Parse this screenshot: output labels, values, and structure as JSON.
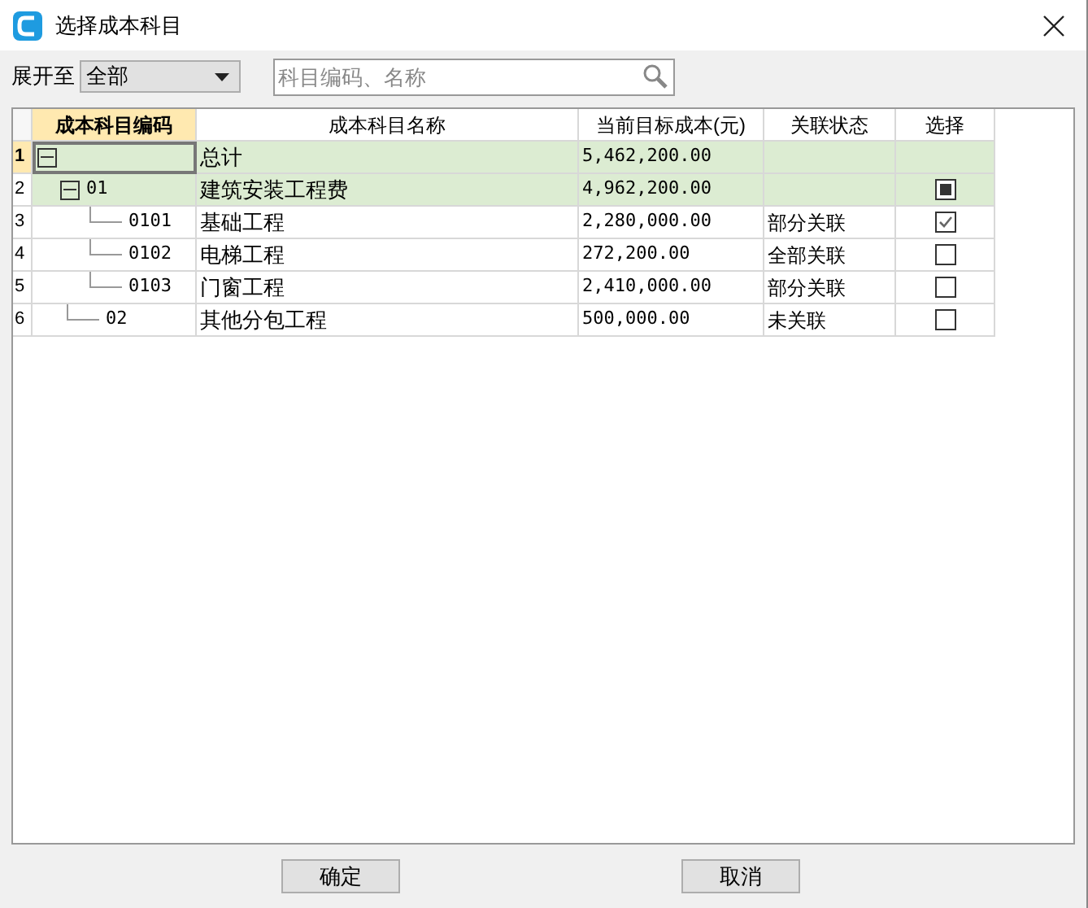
{
  "window": {
    "title": "选择成本科目"
  },
  "filter": {
    "label": "展开至",
    "value": "全部"
  },
  "search": {
    "placeholder": "科目编码、名称"
  },
  "table": {
    "columns": [
      "成本科目编码",
      "成本科目名称",
      "当前目标成本(元)",
      "关联状态",
      "选择"
    ],
    "rows": [
      {
        "number": "1",
        "name": "总计",
        "cost": "5,462,200.00",
        "expanded": true,
        "highlighted": true,
        "selected": true,
        "children": [
          {
            "number": "2",
            "code": "01",
            "name": "建筑安装工程费",
            "cost": "4,962,200.00",
            "expanded": true,
            "highlighted": true,
            "selected": false,
            "checked": false,
            "partial": true,
            "children": [
              {
                "number": "3",
                "code": "0101",
                "name": "基础工程",
                "cost": "2,280,000.00",
                "status": "部分关联",
                "highlighted": false,
                "selected": false,
                "checked": true,
                "partial": false
              },
              {
                "number": "4",
                "code": "0102",
                "name": "电梯工程",
                "cost": "272,200.00",
                "status": "全部关联",
                "highlighted": false,
                "selected": false,
                "checked": false,
                "partial": false
              },
              {
                "number": "5",
                "code": "0103",
                "name": "门窗工程",
                "cost": "2,410,000.00",
                "status": "部分关联",
                "highlighted": false,
                "selected": false,
                "checked": false,
                "partial": false
              }
            ]
          },
          {
            "number": "6",
            "code": "02",
            "name": "其他分包工程",
            "cost": "500,000.00",
            "status": "未关联",
            "highlighted": false,
            "selected": false,
            "checked": false,
            "partial": false
          }
        ]
      }
    ]
  },
  "buttons": [
    "确定",
    "取消"
  ]
}
